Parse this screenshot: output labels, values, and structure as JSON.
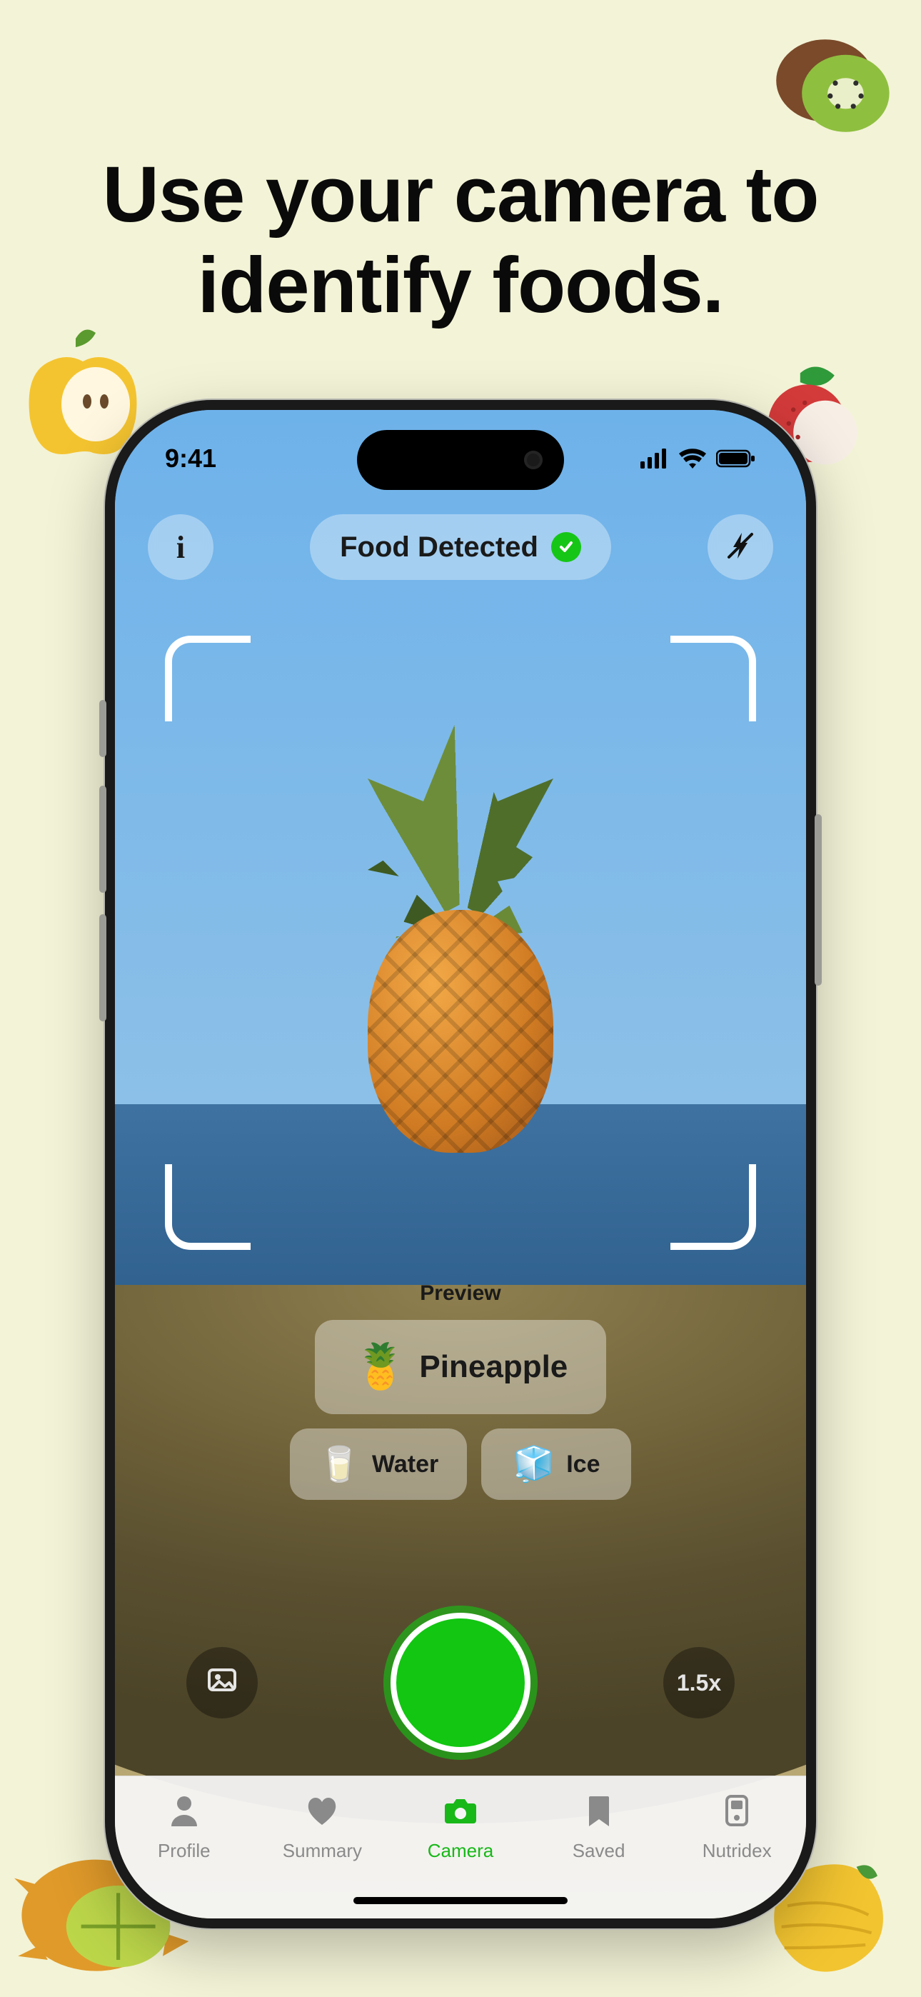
{
  "promo": {
    "headline_line1": "Use your camera to",
    "headline_line2": "identify foods."
  },
  "status": {
    "time": "9:41"
  },
  "toprow": {
    "info_icon": "i",
    "pill_label": "Food Detected",
    "flash_icon": "flash-off"
  },
  "preview": {
    "label": "Preview",
    "primary": {
      "emoji": "🍍",
      "name": "Pineapple"
    },
    "secondary": [
      {
        "emoji": "🥛",
        "name": "Water"
      },
      {
        "emoji": "🧊",
        "name": "Ice"
      }
    ]
  },
  "controls": {
    "zoom": "1.5x"
  },
  "tabs": [
    {
      "id": "profile",
      "label": "Profile",
      "active": false
    },
    {
      "id": "summary",
      "label": "Summary",
      "active": false
    },
    {
      "id": "camera",
      "label": "Camera",
      "active": true
    },
    {
      "id": "saved",
      "label": "Saved",
      "active": false
    },
    {
      "id": "nutridex",
      "label": "Nutridex",
      "active": false
    }
  ],
  "deco_fruits": [
    "kiwi",
    "apple",
    "lychee",
    "horned-melon",
    "mango"
  ]
}
